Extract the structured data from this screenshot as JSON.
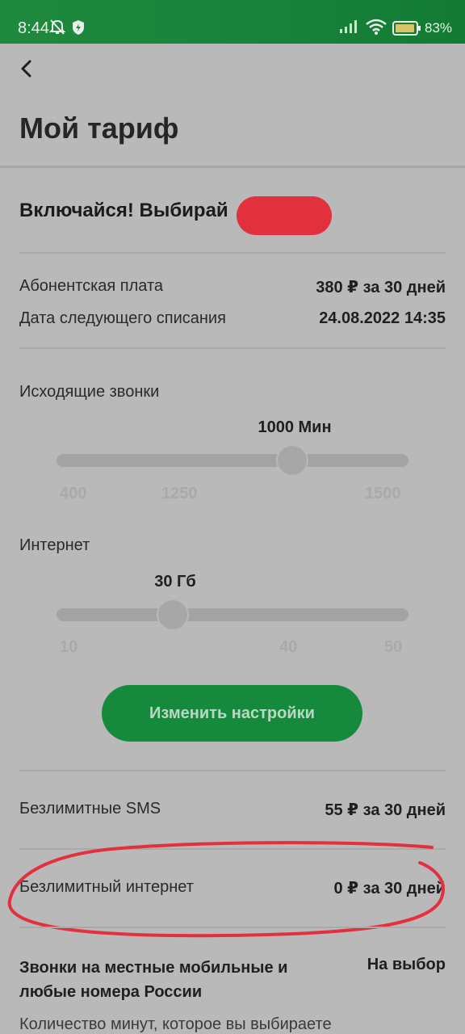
{
  "status_bar": {
    "time": "8:44",
    "battery_percent": "83",
    "battery_percent_suffix": "%",
    "icons": [
      "bell-muted-icon",
      "shield-icon",
      "signal-icon",
      "wifi-icon",
      "battery-icon"
    ]
  },
  "header": {
    "back_icon": "chevron-left-icon",
    "title": "Мой тариф"
  },
  "tariff": {
    "name": "Включайся! Выбирай"
  },
  "fees": [
    {
      "label": "Абонентская плата",
      "value": "380 ₽ за 30 дней"
    },
    {
      "label": "Дата следующего списания",
      "value": "24.08.2022 14:35"
    }
  ],
  "calls_slider": {
    "label": "Исходящие звонки",
    "value_label": "1000 Мин",
    "ticks": [
      "400",
      "1250",
      "1500"
    ],
    "position": 0.67
  },
  "internet_slider": {
    "label": "Интернет",
    "value_label": "30 Гб",
    "ticks": [
      "10",
      "40",
      "50"
    ],
    "position": 0.33
  },
  "actions": {
    "change_settings": "Изменить настройки"
  },
  "options": [
    {
      "label": "Безлимитные SMS",
      "value": "55 ₽ за 30 дней"
    },
    {
      "label": "Безлимитный интернет",
      "value": "0 ₽ за 30 дней"
    }
  ],
  "calls_option": {
    "line1": "Звонки на местные мобильные и",
    "line2": "любые номера России",
    "value": "На выбор"
  },
  "cut_off_text": "Количество минут, которое вы выбираете",
  "colors": {
    "brand_green": "#168a3c",
    "overlay_gray": "#b9b9b9",
    "annotation_red": "#e3303f"
  }
}
